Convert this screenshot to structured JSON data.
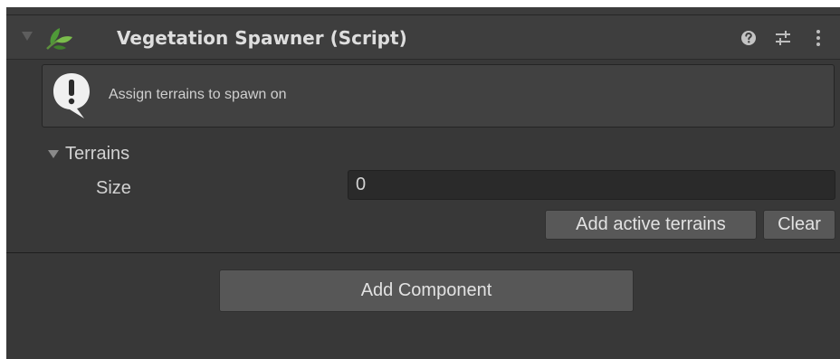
{
  "header": {
    "title": "Vegetation Spawner (Script)",
    "icons": [
      "foldout-arrow-icon",
      "leaf-icon",
      "help-icon",
      "preset-icon",
      "kebab-menu-icon"
    ]
  },
  "helpbox": {
    "icon": "warning-icon",
    "message": "Assign terrains to spawn on"
  },
  "terrains": {
    "label": "Terrains",
    "expanded": true,
    "size_label": "Size",
    "size_value": "0",
    "add_active_label": "Add active terrains",
    "clear_label": "Clear"
  },
  "footer": {
    "add_component_label": "Add Component"
  },
  "colors": {
    "panel_bg": "#383838",
    "header_bg": "#3e3e3e",
    "button_bg": "#585858",
    "input_bg": "#2a2a2a",
    "text": "#d2d2d2"
  }
}
